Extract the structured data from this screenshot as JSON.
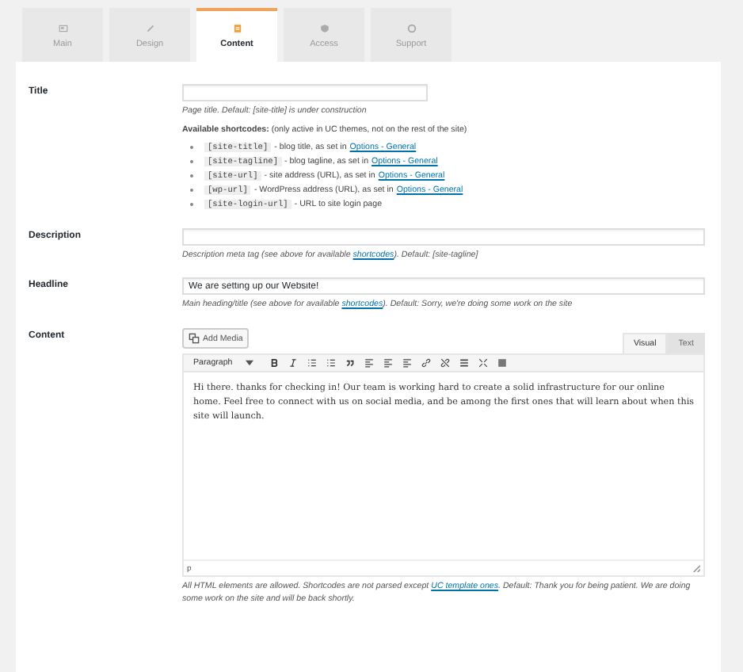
{
  "tabs": [
    {
      "label": "Main",
      "selected": false
    },
    {
      "label": "Design",
      "selected": false
    },
    {
      "label": "Content",
      "selected": true
    },
    {
      "label": "Access",
      "selected": false
    },
    {
      "label": "Support",
      "selected": false
    }
  ],
  "title": {
    "label": "Title",
    "help": "Page title. Default: [site-title] is under construction",
    "shortcodes_heading": "Available shortcodes:",
    "shortcodes_note": "(only active in UC themes, not on the rest of the site)",
    "shortcodes": [
      {
        "code": "[site-title]",
        "text": "- blog title, as set in",
        "link": "Options - General"
      },
      {
        "code": "[site-tagline]",
        "text": "- blog tagline, as set in",
        "link": "Options - General"
      },
      {
        "code": "[site-url]",
        "text": "- site address (URL), as set in",
        "link": "Options - General"
      },
      {
        "code": "[wp-url]",
        "text": "- WordPress address (URL), as set in",
        "link": "Options - General"
      },
      {
        "code": "[site-login-url]",
        "text": "- URL to site login page"
      }
    ]
  },
  "description": {
    "label": "Description",
    "help_before": "Description meta tag (see above for available",
    "help_link": "shortcodes",
    "help_after": "). Default: [site-tagline]"
  },
  "headline": {
    "label": "Headline",
    "value": "We are setting up our Website!",
    "help_before": "Main heading/title (see above for available",
    "help_link": "shortcodes",
    "help_after": "). Default: Sorry, we're doing some work on the site"
  },
  "content": {
    "label": "Content",
    "add_media": "Add Media",
    "views": [
      {
        "label": "Visual",
        "selected": true
      },
      {
        "label": "Text",
        "selected": false
      }
    ],
    "format": "Paragraph",
    "body": "Hi there. thanks for checking in! Our team is working hard to create a solid infrastructure for our online home. Feel free to connect with us on social media, and be among the first ones that will learn about when this site will launch.",
    "path": "p",
    "help_before": "All HTML elements are allowed. Shortcodes are not parsed except",
    "help_link": "UC template ones",
    "help_after": ". Default: Thank you for being patient. We are doing some work on the site and will be back shortly."
  }
}
